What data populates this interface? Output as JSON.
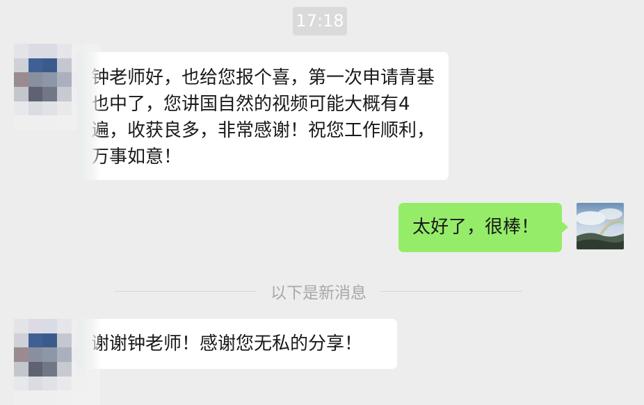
{
  "timestamp": "17:18",
  "messages": [
    {
      "side": "left",
      "text": "钟老师好，也给您报个喜，第一次申请青基也中了，您讲国自然的视频可能大概有4遍，收获良多，非常感谢！祝您工作顺利，万事如意！"
    },
    {
      "side": "right",
      "text": "太好了，很棒！"
    },
    {
      "side": "left",
      "text": "谢谢钟老师！感谢您无私的分享！"
    }
  ],
  "divider": {
    "label": "以下是新消息"
  },
  "colors": {
    "background": "#ededed",
    "bubble_left": "#ffffff",
    "bubble_right": "#95ec69",
    "text": "#191919",
    "divider_text": "#a8a8a8",
    "time_badge": "#dadada"
  },
  "icons": {
    "left_avatar": "blurred-avatar-icon",
    "right_avatar": "landscape-rainbow-avatar-icon"
  }
}
